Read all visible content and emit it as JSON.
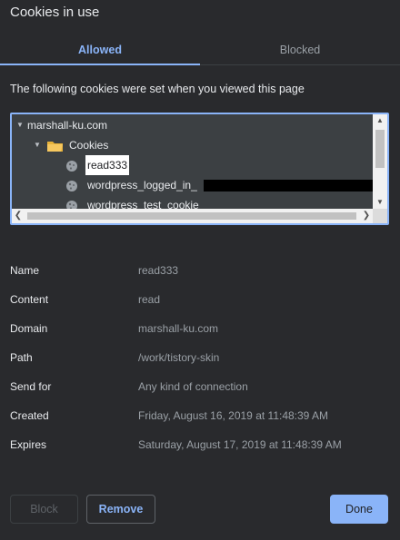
{
  "dialog": {
    "title": "Cookies in use"
  },
  "tabs": [
    {
      "label": "Allowed",
      "active": true
    },
    {
      "label": "Blocked",
      "active": false
    }
  ],
  "intro_text": "The following cookies were set when you viewed this page",
  "tree": {
    "site": "marshall-ku.com",
    "folder": "Cookies",
    "cookies": [
      "read333",
      "wordpress_logged_in_",
      "wordpress_test_cookie"
    ],
    "selected": "read333"
  },
  "details": [
    {
      "label": "Name",
      "value": "read333"
    },
    {
      "label": "Content",
      "value": "read"
    },
    {
      "label": "Domain",
      "value": "marshall-ku.com"
    },
    {
      "label": "Path",
      "value": "/work/tistory-skin"
    },
    {
      "label": "Send for",
      "value": "Any kind of connection"
    },
    {
      "label": "Created",
      "value": "Friday, August 16, 2019 at 11:48:39 AM"
    },
    {
      "label": "Expires",
      "value": "Saturday, August 17, 2019 at 11:48:39 AM"
    }
  ],
  "buttons": {
    "block": "Block",
    "remove": "Remove",
    "done": "Done"
  },
  "colors": {
    "accent": "#8ab4f8",
    "background": "#292a2d",
    "tree_bg": "#3c4043"
  }
}
